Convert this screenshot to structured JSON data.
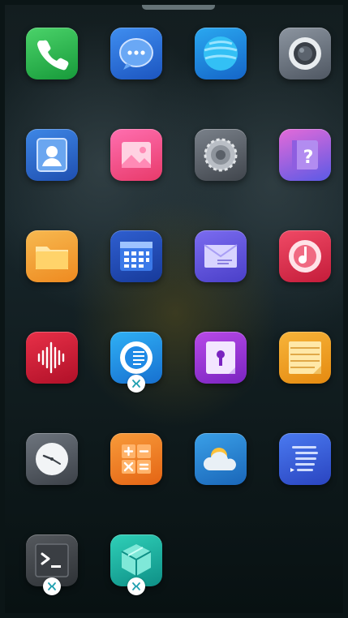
{
  "screen": {
    "apps": [
      {
        "id": "phone",
        "icon": "phone-icon"
      },
      {
        "id": "messages",
        "icon": "chat-bubble-icon"
      },
      {
        "id": "browser",
        "icon": "globe-icon"
      },
      {
        "id": "camera",
        "icon": "camera-lens-icon"
      },
      {
        "id": "contacts",
        "icon": "contact-card-icon"
      },
      {
        "id": "gallery",
        "icon": "photo-icon"
      },
      {
        "id": "settings",
        "icon": "gear-icon"
      },
      {
        "id": "help",
        "icon": "question-icon"
      },
      {
        "id": "files",
        "icon": "folder-icon"
      },
      {
        "id": "calendar",
        "icon": "calendar-icon"
      },
      {
        "id": "mail",
        "icon": "envelope-icon"
      },
      {
        "id": "music",
        "icon": "music-disc-icon"
      },
      {
        "id": "recorder",
        "icon": "waveform-icon"
      },
      {
        "id": "reader",
        "icon": "reader-icon"
      },
      {
        "id": "vault",
        "icon": "keyhole-icon"
      },
      {
        "id": "notes",
        "icon": "notepad-icon"
      },
      {
        "id": "clock",
        "icon": "clock-icon"
      },
      {
        "id": "calculator",
        "icon": "calculator-icon"
      },
      {
        "id": "weather",
        "icon": "cloud-sun-icon"
      },
      {
        "id": "list",
        "icon": "list-icon"
      },
      {
        "id": "terminal",
        "icon": "terminal-icon"
      },
      {
        "id": "package",
        "icon": "box-icon"
      }
    ],
    "badges": [
      "reader",
      "terminal",
      "package"
    ],
    "colors": {
      "phone": "#2db34a",
      "messages": "#2a6fd6",
      "browser": "#1f8fe0",
      "camera": "#6b7480",
      "contacts": "#2e6dcf",
      "gallery": "#ef4f8a",
      "settings": "#5b6068",
      "help": "#8a52e0",
      "files": "#f2a530",
      "calendar": "#2450c0",
      "mail": "#6a5ae6",
      "music": "#e23048",
      "recorder": "#d4203a",
      "reader": "#1f96e6",
      "vault": "#9a3ed6",
      "notes": "#f0a020",
      "clock": "#5f6670",
      "calculator": "#f27a1f",
      "weather": "#2f8fd6",
      "list": "#3560e0",
      "terminal": "#4a4e52",
      "package": "#1fbfa8",
      "badge": "#1fa0b0"
    }
  }
}
